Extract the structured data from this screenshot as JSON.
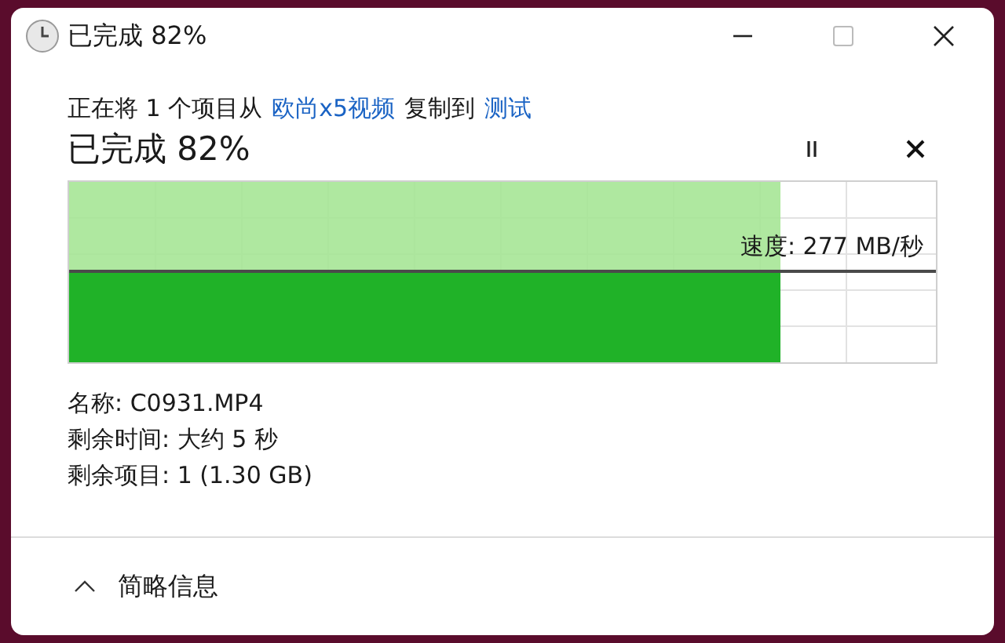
{
  "window": {
    "title": "已完成 82%"
  },
  "copy_line": [
    {
      "kind": "text",
      "text": "正在将 1 个项目从"
    },
    {
      "kind": "link",
      "text": "欧尚x5视频"
    },
    {
      "kind": "text",
      "text": "复制到"
    },
    {
      "kind": "link",
      "text": "测试"
    }
  ],
  "status": "已完成 82%",
  "progress": {
    "level": 0.82,
    "speed": "速度: 277 MB/秒"
  },
  "details": [
    "名称: C0931.MP4",
    "剩余时间: 大约 5 秒",
    "剩余项目: 1 (1.30 GB)"
  ],
  "toggle": {
    "label": "简略信息",
    "expanded": true
  }
}
